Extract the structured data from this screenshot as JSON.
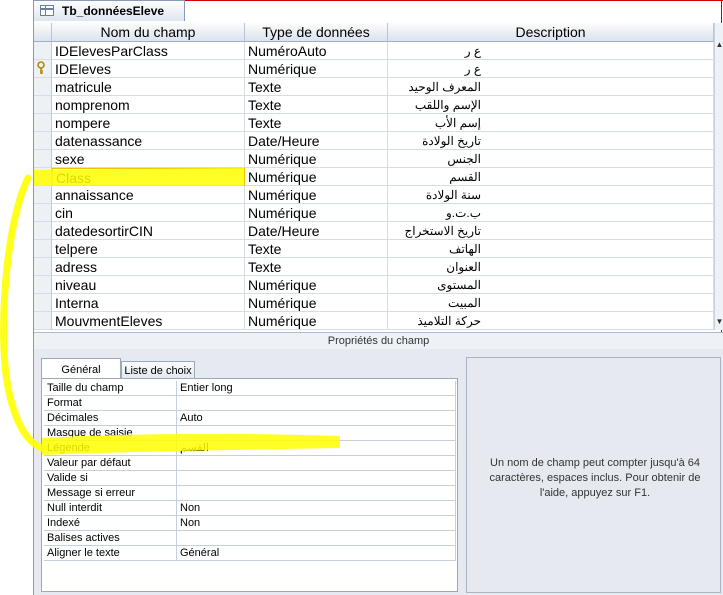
{
  "tab": {
    "title": "Tb_donnéesEleve"
  },
  "grid": {
    "headers": [
      "Nom du champ",
      "Type de données",
      "Description"
    ],
    "rows": [
      {
        "name": "IDElevesParClass",
        "type": "NuméroAuto",
        "desc": "ع ر",
        "key": false
      },
      {
        "name": "IDEleves",
        "type": "Numérique",
        "desc": "ع ر",
        "key": true
      },
      {
        "name": "matricule",
        "type": "Texte",
        "desc": "المعرف الوحيد",
        "key": false
      },
      {
        "name": "nomprenom",
        "type": "Texte",
        "desc": "الإسم واللقب",
        "key": false
      },
      {
        "name": "nompere",
        "type": "Texte",
        "desc": "إسم الأب",
        "key": false
      },
      {
        "name": "datenassance",
        "type": "Date/Heure",
        "desc": "تاريخ الولادة",
        "key": false
      },
      {
        "name": "sexe",
        "type": "Numérique",
        "desc": "الجنس",
        "key": false
      },
      {
        "name": "Class",
        "type": "Numérique",
        "desc": "القسم",
        "key": false
      },
      {
        "name": "annaissance",
        "type": "Numérique",
        "desc": "سنة الولادة",
        "key": false
      },
      {
        "name": "cin",
        "type": "Numérique",
        "desc": "ب.ت.و",
        "key": false
      },
      {
        "name": "datedesortirCIN",
        "type": "Date/Heure",
        "desc": "تاريخ الاستخراج",
        "key": false
      },
      {
        "name": "telpere",
        "type": "Texte",
        "desc": "الهاتف",
        "key": false
      },
      {
        "name": "adress",
        "type": "Texte",
        "desc": "العنوان",
        "key": false
      },
      {
        "name": "niveau",
        "type": "Numérique",
        "desc": "المستوى",
        "key": false
      },
      {
        "name": "Interna",
        "type": "Numérique",
        "desc": "المبيت",
        "key": false
      },
      {
        "name": "MouvmentEleves",
        "type": "Numérique",
        "desc": "حركة التلاميذ",
        "key": false
      }
    ]
  },
  "section_title": "Propriétés du champ",
  "tabs": {
    "general": "Général",
    "lookup": "Liste de choix"
  },
  "properties": [
    {
      "label": "Taille du champ",
      "value": "Entier long"
    },
    {
      "label": "Format",
      "value": ""
    },
    {
      "label": "Décimales",
      "value": "Auto"
    },
    {
      "label": "Masque de saisie",
      "value": ""
    },
    {
      "label": "Légende",
      "value": "القسم"
    },
    {
      "label": "Valeur par défaut",
      "value": ""
    },
    {
      "label": "Valide si",
      "value": ""
    },
    {
      "label": "Message si erreur",
      "value": ""
    },
    {
      "label": "Null interdit",
      "value": "Non"
    },
    {
      "label": "Indexé",
      "value": "Non"
    },
    {
      "label": "Balises actives",
      "value": ""
    },
    {
      "label": "Aligner le texte",
      "value": "Général"
    }
  ],
  "help": "Un nom de champ peut compter jusqu'à 64 caractères, espaces inclus. Pour obtenir de l'aide, appuyez sur F1.",
  "colors": {
    "highlighter": "#ffff00",
    "accent_red": "#cc0000",
    "selection_border": "#f2c200"
  }
}
